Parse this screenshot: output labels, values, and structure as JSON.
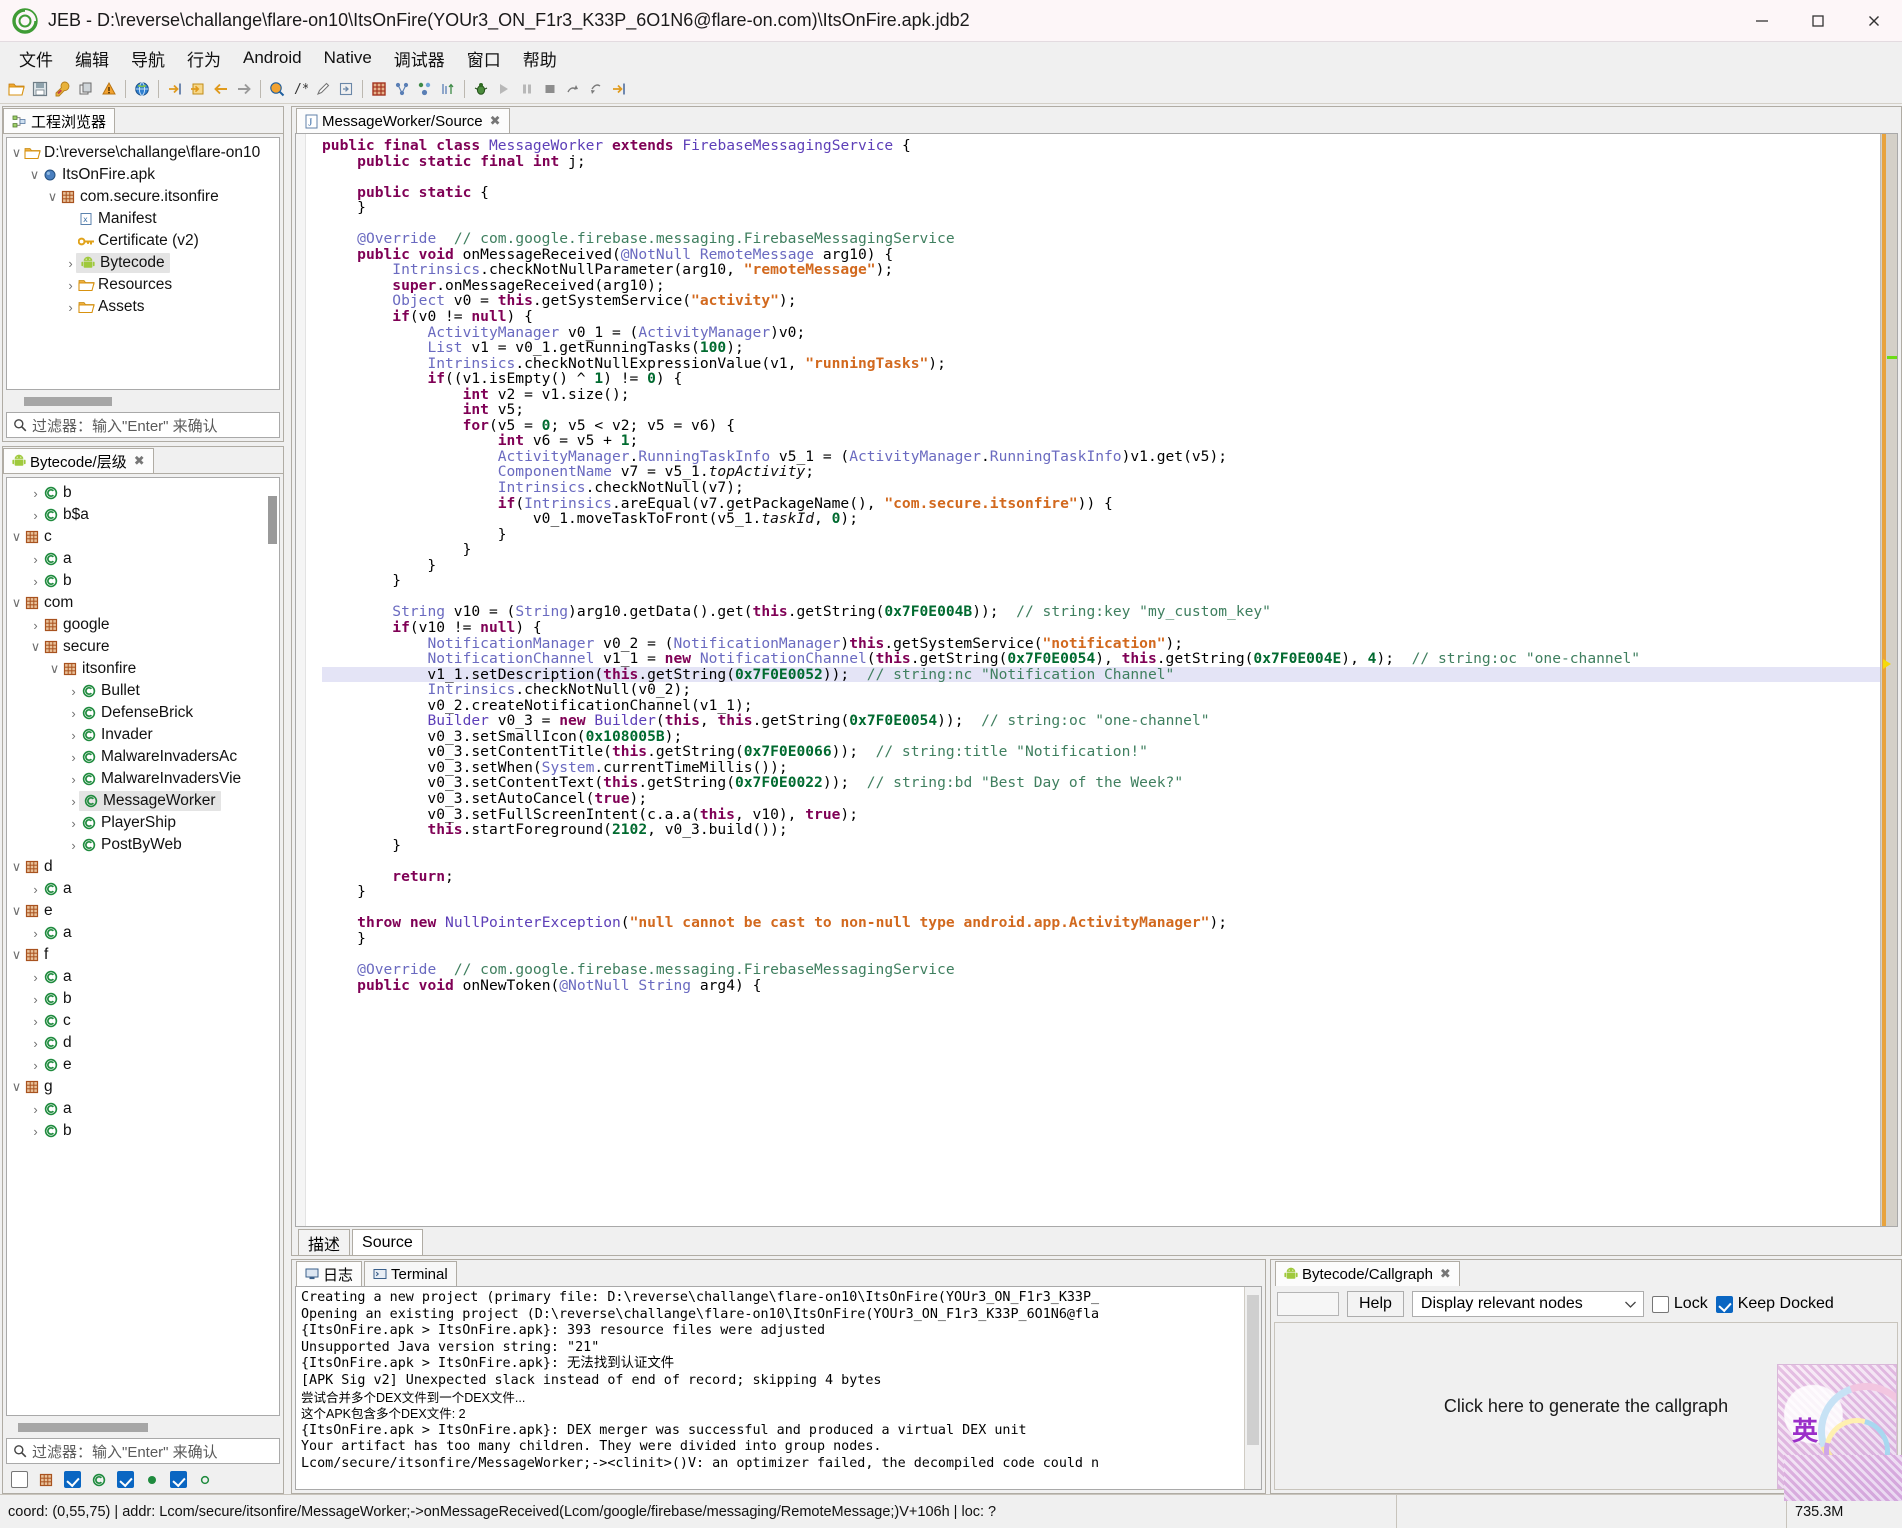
{
  "window": {
    "title": "JEB - D:\\reverse\\challange\\flare-on10\\ItsOnFire(YOUr3_ON_F1r3_K33P_6O1N6@flare-on.com)\\ItsOnFire.apk.jdb2",
    "minimize": "—",
    "maximize": "☐",
    "close": "✕"
  },
  "menu": [
    "文件",
    "编辑",
    "导航",
    "行为",
    "Android",
    "Native",
    "调试器",
    "窗口",
    "帮助"
  ],
  "toolbar_icons": [
    "open-folder-icon",
    "save-icon",
    "wrench-icon",
    "copy-icon",
    "warning-icon",
    "sep",
    "globe-icon",
    "goto-icon",
    "goto-address-icon",
    "back-arrow-icon",
    "forward-arrow-icon",
    "sep",
    "search-globe-icon",
    "comment-icon",
    "pencil-icon",
    "export-icon",
    "sep",
    "grid-icon",
    "graph-icon",
    "nodes-icon",
    "sort-icon",
    "sep",
    "debug-bug-icon",
    "run-icon",
    "pause-icon",
    "stop-icon",
    "step-over-icon",
    "step-return-icon",
    "step-into-icon"
  ],
  "project_explorer": {
    "tab_label": "工程浏览器",
    "tab_icon": "project-tree-icon",
    "filter_placeholder": "过滤器：输入\"Enter\" 来确认",
    "filter_icon": "search-icon",
    "tree": [
      {
        "label": "D:\\reverse\\challange\\flare-on10",
        "indent": 0,
        "twisty": "open",
        "icon": "folder-icon",
        "selected": false
      },
      {
        "label": "ItsOnFire.apk",
        "indent": 1,
        "twisty": "open",
        "icon": "apk-dot-icon",
        "selected": false
      },
      {
        "label": "com.secure.itsonfire",
        "indent": 2,
        "twisty": "open",
        "icon": "package-icon",
        "selected": false
      },
      {
        "label": "Manifest",
        "indent": 3,
        "twisty": "none",
        "icon": "xml-icon",
        "selected": false
      },
      {
        "label": "Certificate (v2)",
        "indent": 3,
        "twisty": "none",
        "icon": "key-icon",
        "selected": false
      },
      {
        "label": "Bytecode",
        "indent": 3,
        "twisty": "closed",
        "icon": "android-icon",
        "selected": true
      },
      {
        "label": "Resources",
        "indent": 3,
        "twisty": "closed",
        "icon": "folder-icon",
        "selected": false
      },
      {
        "label": "Assets",
        "indent": 3,
        "twisty": "closed",
        "icon": "folder-icon",
        "selected": false
      }
    ]
  },
  "hierarchy": {
    "tab_label": "Bytecode/层级",
    "tab_icon": "android-icon",
    "filter_placeholder": "过滤器：输入\"Enter\" 来确认",
    "filter_icon": "search-icon",
    "tree": [
      {
        "label": "b",
        "indent": 1,
        "twisty": "closed",
        "icon": "class-icon"
      },
      {
        "label": "b$a",
        "indent": 1,
        "twisty": "closed",
        "icon": "class-icon"
      },
      {
        "label": "c",
        "indent": 0,
        "twisty": "open",
        "icon": "package-icon"
      },
      {
        "label": "a",
        "indent": 1,
        "twisty": "closed",
        "icon": "class-icon"
      },
      {
        "label": "b",
        "indent": 1,
        "twisty": "closed",
        "icon": "class-icon"
      },
      {
        "label": "com",
        "indent": 0,
        "twisty": "open",
        "icon": "package-icon"
      },
      {
        "label": "google",
        "indent": 1,
        "twisty": "closed",
        "icon": "package-icon"
      },
      {
        "label": "secure",
        "indent": 1,
        "twisty": "open",
        "icon": "package-icon"
      },
      {
        "label": "itsonfire",
        "indent": 2,
        "twisty": "open",
        "icon": "package-icon"
      },
      {
        "label": "Bullet",
        "indent": 3,
        "twisty": "closed",
        "icon": "class-icon"
      },
      {
        "label": "DefenseBrick",
        "indent": 3,
        "twisty": "closed",
        "icon": "class-icon"
      },
      {
        "label": "Invader",
        "indent": 3,
        "twisty": "closed",
        "icon": "class-icon"
      },
      {
        "label": "MalwareInvadersAc",
        "indent": 3,
        "twisty": "closed",
        "icon": "class-icon"
      },
      {
        "label": "MalwareInvadersVie",
        "indent": 3,
        "twisty": "closed",
        "icon": "class-icon"
      },
      {
        "label": "MessageWorker",
        "indent": 3,
        "twisty": "closed",
        "icon": "class-icon",
        "selected": true
      },
      {
        "label": "PlayerShip",
        "indent": 3,
        "twisty": "closed",
        "icon": "class-icon"
      },
      {
        "label": "PostByWeb",
        "indent": 3,
        "twisty": "closed",
        "icon": "class-icon"
      },
      {
        "label": "d",
        "indent": 0,
        "twisty": "open",
        "icon": "package-icon"
      },
      {
        "label": "a",
        "indent": 1,
        "twisty": "closed",
        "icon": "class-icon"
      },
      {
        "label": "e",
        "indent": 0,
        "twisty": "open",
        "icon": "package-icon"
      },
      {
        "label": "a",
        "indent": 1,
        "twisty": "closed",
        "icon": "class-icon"
      },
      {
        "label": "f",
        "indent": 0,
        "twisty": "open",
        "icon": "package-icon"
      },
      {
        "label": "a",
        "indent": 1,
        "twisty": "closed",
        "icon": "class-icon"
      },
      {
        "label": "b",
        "indent": 1,
        "twisty": "closed",
        "icon": "class-icon"
      },
      {
        "label": "c",
        "indent": 1,
        "twisty": "closed",
        "icon": "class-icon"
      },
      {
        "label": "d",
        "indent": 1,
        "twisty": "closed",
        "icon": "class-icon"
      },
      {
        "label": "e",
        "indent": 1,
        "twisty": "closed",
        "icon": "class-icon"
      },
      {
        "label": "g",
        "indent": 0,
        "twisty": "open",
        "icon": "package-icon"
      },
      {
        "label": "a",
        "indent": 1,
        "twisty": "closed",
        "icon": "class-icon"
      },
      {
        "label": "b",
        "indent": 1,
        "twisty": "closed",
        "icon": "class-icon"
      }
    ],
    "toggles": [
      {
        "name": "filter-toggle-blank",
        "state": "off",
        "kind": "checkbox"
      },
      {
        "name": "package-filter-icon",
        "state": "icon",
        "kind": "package-icon"
      },
      {
        "name": "show-classes-toggle",
        "state": "on",
        "kind": "checkbox"
      },
      {
        "name": "class-filter-icon",
        "state": "icon",
        "kind": "class-icon"
      },
      {
        "name": "show-methods-toggle",
        "state": "on",
        "kind": "checkbox"
      },
      {
        "name": "method-filter-icon",
        "state": "icon",
        "kind": "dot-filled-icon"
      },
      {
        "name": "show-fields-toggle",
        "state": "on",
        "kind": "checkbox"
      },
      {
        "name": "field-filter-icon",
        "state": "icon",
        "kind": "dot-hollow-icon"
      }
    ]
  },
  "editor": {
    "tab_label": "MessageWorker/Source",
    "tab_icon": "java-source-icon",
    "tab_close": "✖",
    "bottom_tabs": [
      {
        "label": "描述",
        "active": false
      },
      {
        "label": "Source",
        "active": true
      }
    ]
  },
  "code_lines": [
    "public final class MessageWorker extends FirebaseMessagingService {",
    "    public static final int j;",
    "",
    "    public static {",
    "    }",
    "",
    "    @Override  // com.google.firebase.messaging.FirebaseMessagingService",
    "    public void onMessageReceived(@NotNull RemoteMessage arg10) {",
    "        Intrinsics.checkNotNullParameter(arg10, \"remoteMessage\");",
    "        super.onMessageReceived(arg10);",
    "        Object v0 = this.getSystemService(\"activity\");",
    "        if(v0 != null) {",
    "            ActivityManager v0_1 = (ActivityManager)v0;",
    "            List v1 = v0_1.getRunningTasks(100);",
    "            Intrinsics.checkNotNullExpressionValue(v1, \"runningTasks\");",
    "            if((v1.isEmpty() ^ 1) != 0) {",
    "                int v2 = v1.size();",
    "                int v5;",
    "                for(v5 = 0; v5 < v2; v5 = v6) {",
    "                    int v6 = v5 + 1;",
    "                    ActivityManager.RunningTaskInfo v5_1 = (ActivityManager.RunningTaskInfo)v1.get(v5);",
    "                    ComponentName v7 = v5_1.topActivity;",
    "                    Intrinsics.checkNotNull(v7);",
    "                    if(Intrinsics.areEqual(v7.getPackageName(), \"com.secure.itsonfire\")) {",
    "                        v0_1.moveTaskToFront(v5_1.taskId, 0);",
    "                    }",
    "                }",
    "            }",
    "        }",
    "",
    "        String v10 = (String)arg10.getData().get(this.getString(0x7F0E004B));  // string:key \"my_custom_key\"",
    "        if(v10 != null) {",
    "            NotificationManager v0_2 = (NotificationManager)this.getSystemService(\"notification\");",
    "            NotificationChannel v1_1 = new NotificationChannel(this.getString(0x7F0E0054), this.getString(0x7F0E004E), 4);  // string:oc \"one-channel\"",
    "            v1_1.setDescription(this.getString(0x7F0E0052));  // string:nc \"Notification Channel\"",
    "            Intrinsics.checkNotNull(v0_2);",
    "            v0_2.createNotificationChannel(v1_1);",
    "            Builder v0_3 = new Builder(this, this.getString(0x7F0E0054));  // string:oc \"one-channel\"",
    "            v0_3.setSmallIcon(0x108005B);",
    "            v0_3.setContentTitle(this.getString(0x7F0E0066));  // string:title \"Notification!\"",
    "            v0_3.setWhen(System.currentTimeMillis());",
    "            v0_3.setContentText(this.getString(0x7F0E0022));  // string:bd \"Best Day of the Week?\"",
    "            v0_3.setAutoCancel(true);",
    "            v0_3.setFullScreenIntent(c.a.a(this, v10), true);",
    "            this.startForeground(2102, v0_3.build());",
    "        }",
    "",
    "        return;",
    "    }",
    "",
    "    throw new NullPointerException(\"null cannot be cast to non-null type android.app.ActivityManager\");",
    "    }",
    "",
    "    @Override  // com.google.firebase.messaging.FirebaseMessagingService",
    "    public void onNewToken(@NotNull String arg4) {"
  ],
  "log_panel": {
    "tabs": [
      {
        "label": "日志",
        "icon": "log-icon",
        "active": true
      },
      {
        "label": "Terminal",
        "icon": "terminal-icon",
        "active": false
      }
    ],
    "lines": [
      "Creating a new project (primary file: D:\\reverse\\challange\\flare-on10\\ItsOnFire(YOUr3_ON_F1r3_K33P_",
      "Opening an existing project (D:\\reverse\\challange\\flare-on10\\ItsOnFire(YOUr3_ON_F1r3_K33P_6O1N6@fla",
      "{ItsOnFire.apk > ItsOnFire.apk}: 393 resource files were adjusted",
      "Unsupported Java version string: \"21\"",
      "{ItsOnFire.apk > ItsOnFire.apk}: 无法找到认证文件",
      "[APK Sig v2] Unexpected slack instead of end of record; skipping 4 bytes",
      "尝试合并多个DEX文件到一个DEX文件...",
      "这个APK包含多个DEX文件: 2",
      "{ItsOnFire.apk > ItsOnFire.apk}: DEX merger was successful and produced a virtual DEX unit",
      "Your artifact has too many children. They were divided into group nodes.",
      "Lcom/secure/itsonfire/MessageWorker;-><clinit>()V: an optimizer failed, the decompiled code could n"
    ]
  },
  "callgraph": {
    "tab_label": "Bytecode/Callgraph",
    "tab_icon": "android-icon",
    "tab_close": "✖",
    "input_value": "",
    "help_label": "Help",
    "select_value": "Display relevant nodes",
    "select_caret": "⌄",
    "lock_label": "Lock",
    "lock_checked": false,
    "keep_docked_label": "Keep Docked",
    "keep_docked_checked": true,
    "hint": "Click here to generate the callgraph",
    "sticker_glyph": "英"
  },
  "statusbar": {
    "text": "coord: (0,55,75) | addr: Lcom/secure/itsonfire/MessageWorker;->onMessageReceived(Lcom/google/firebase/messaging/RemoteMessage;)V+106h | loc: ?",
    "memory": "735.3M"
  },
  "colors": {
    "accent_blue": "#0a66c2",
    "keyword": "#7f0055",
    "string": "#d2691e",
    "number": "#006a2f",
    "comment": "#3f7f5f",
    "type": "#6a6ac0",
    "highlight_row": "#e4e4f6",
    "titlebar_bg": "#fdf6f8"
  }
}
